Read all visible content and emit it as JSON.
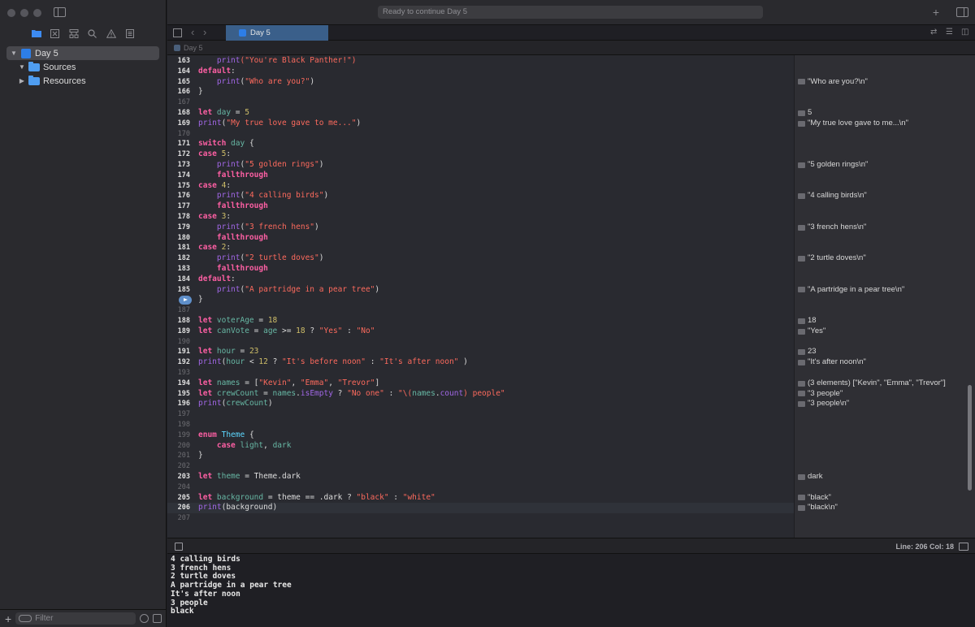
{
  "window": {
    "status": "Ready to continue Day 5"
  },
  "sidebar": {
    "tree": [
      {
        "label": "Day 5",
        "expanded": true,
        "selected": true,
        "kind": "playground"
      },
      {
        "label": "Sources",
        "expanded": true,
        "kind": "folder"
      },
      {
        "label": "Resources",
        "expanded": false,
        "kind": "folder"
      }
    ],
    "filter_placeholder": "Filter"
  },
  "tabs": [
    {
      "label": "Day 5",
      "active": true
    }
  ],
  "jumpbar": {
    "path": "Day 5"
  },
  "editor": {
    "lines": [
      {
        "n": "163",
        "code": [
          [
            "    ",
            "p"
          ],
          [
            "print",
            "f"
          ],
          [
            "(\"You're Black Panther!\")",
            "s"
          ]
        ]
      },
      {
        "n": "164",
        "code": [
          [
            "default",
            "k"
          ],
          [
            ":",
            "p"
          ]
        ]
      },
      {
        "n": "165",
        "code": [
          [
            "    ",
            "p"
          ],
          [
            "print",
            "f"
          ],
          [
            "(",
            "p"
          ],
          [
            "\"Who are you?\"",
            "s"
          ],
          [
            ")",
            "p"
          ]
        ],
        "result": "\"Who are you?\\n\""
      },
      {
        "n": "166",
        "code": [
          [
            "}",
            "p"
          ]
        ]
      },
      {
        "n": "167",
        "code": [],
        "dim": true
      },
      {
        "n": "168",
        "code": [
          [
            "let ",
            "k"
          ],
          [
            "day",
            "v"
          ],
          [
            " = ",
            "p"
          ],
          [
            "5",
            "n"
          ]
        ],
        "result": "5"
      },
      {
        "n": "169",
        "code": [
          [
            "print",
            "f"
          ],
          [
            "(",
            "p"
          ],
          [
            "\"My true love gave to me...\"",
            "s"
          ],
          [
            ")",
            "p"
          ]
        ],
        "result": "\"My true love gave to me...\\n\""
      },
      {
        "n": "170",
        "code": [],
        "dim": true
      },
      {
        "n": "171",
        "code": [
          [
            "switch ",
            "k"
          ],
          [
            "day",
            "v"
          ],
          [
            " {",
            "p"
          ]
        ]
      },
      {
        "n": "172",
        "code": [
          [
            "case ",
            "k"
          ],
          [
            "5",
            "n"
          ],
          [
            ":",
            "p"
          ]
        ]
      },
      {
        "n": "173",
        "code": [
          [
            "    ",
            "p"
          ],
          [
            "print",
            "f"
          ],
          [
            "(",
            "p"
          ],
          [
            "\"5 golden rings\"",
            "s"
          ],
          [
            ")",
            "p"
          ]
        ],
        "result": "\"5 golden rings\\n\""
      },
      {
        "n": "174",
        "code": [
          [
            "    ",
            "p"
          ],
          [
            "fallthrough",
            "k"
          ]
        ]
      },
      {
        "n": "175",
        "code": [
          [
            "case ",
            "k"
          ],
          [
            "4",
            "n"
          ],
          [
            ":",
            "p"
          ]
        ]
      },
      {
        "n": "176",
        "code": [
          [
            "    ",
            "p"
          ],
          [
            "print",
            "f"
          ],
          [
            "(",
            "p"
          ],
          [
            "\"4 calling birds\"",
            "s"
          ],
          [
            ")",
            "p"
          ]
        ],
        "result": "\"4 calling birds\\n\""
      },
      {
        "n": "177",
        "code": [
          [
            "    ",
            "p"
          ],
          [
            "fallthrough",
            "k"
          ]
        ]
      },
      {
        "n": "178",
        "code": [
          [
            "case ",
            "k"
          ],
          [
            "3",
            "n"
          ],
          [
            ":",
            "p"
          ]
        ]
      },
      {
        "n": "179",
        "code": [
          [
            "    ",
            "p"
          ],
          [
            "print",
            "f"
          ],
          [
            "(",
            "p"
          ],
          [
            "\"3 french hens\"",
            "s"
          ],
          [
            ")",
            "p"
          ]
        ],
        "result": "\"3 french hens\\n\""
      },
      {
        "n": "180",
        "code": [
          [
            "    ",
            "p"
          ],
          [
            "fallthrough",
            "k"
          ]
        ]
      },
      {
        "n": "181",
        "code": [
          [
            "case ",
            "k"
          ],
          [
            "2",
            "n"
          ],
          [
            ":",
            "p"
          ]
        ]
      },
      {
        "n": "182",
        "code": [
          [
            "    ",
            "p"
          ],
          [
            "print",
            "f"
          ],
          [
            "(",
            "p"
          ],
          [
            "\"2 turtle doves\"",
            "s"
          ],
          [
            ")",
            "p"
          ]
        ],
        "result": "\"2 turtle doves\\n\""
      },
      {
        "n": "183",
        "code": [
          [
            "    ",
            "p"
          ],
          [
            "fallthrough",
            "k"
          ]
        ]
      },
      {
        "n": "184",
        "code": [
          [
            "default",
            "k"
          ],
          [
            ":",
            "p"
          ]
        ]
      },
      {
        "n": "185",
        "code": [
          [
            "    ",
            "p"
          ],
          [
            "print",
            "f"
          ],
          [
            "(",
            "p"
          ],
          [
            "\"A partridge in a pear tree\"",
            "s"
          ],
          [
            ")",
            "p"
          ]
        ],
        "result": "\"A partridge in a pear tree\\n\""
      },
      {
        "n": "",
        "code": [
          [
            "}",
            "p"
          ]
        ],
        "run": true
      },
      {
        "n": "187",
        "code": [],
        "dim": true
      },
      {
        "n": "188",
        "code": [
          [
            "let ",
            "k"
          ],
          [
            "voterAge",
            "v"
          ],
          [
            " = ",
            "p"
          ],
          [
            "18",
            "n"
          ]
        ],
        "result": "18"
      },
      {
        "n": "189",
        "code": [
          [
            "let ",
            "k"
          ],
          [
            "canVote",
            "v"
          ],
          [
            " = ",
            "p"
          ],
          [
            "age",
            "v"
          ],
          [
            " >= ",
            "p"
          ],
          [
            "18",
            "n"
          ],
          [
            " ? ",
            "p"
          ],
          [
            "\"Yes\"",
            "s"
          ],
          [
            " : ",
            "p"
          ],
          [
            "\"No\"",
            "s"
          ]
        ],
        "result": "\"Yes\""
      },
      {
        "n": "190",
        "code": [],
        "dim": true
      },
      {
        "n": "191",
        "code": [
          [
            "let ",
            "k"
          ],
          [
            "hour",
            "v"
          ],
          [
            " = ",
            "p"
          ],
          [
            "23",
            "n"
          ]
        ],
        "result": "23"
      },
      {
        "n": "192",
        "code": [
          [
            "print",
            "f"
          ],
          [
            "(",
            "p"
          ],
          [
            "hour",
            "v"
          ],
          [
            " < ",
            "p"
          ],
          [
            "12",
            "n"
          ],
          [
            " ? ",
            "p"
          ],
          [
            "\"It's before noon\"",
            "s"
          ],
          [
            " : ",
            "p"
          ],
          [
            "\"It's after noon\"",
            "s"
          ],
          [
            " )",
            "p"
          ]
        ],
        "result": "\"It's after noon\\n\""
      },
      {
        "n": "193",
        "code": [],
        "dim": true
      },
      {
        "n": "194",
        "code": [
          [
            "let ",
            "k"
          ],
          [
            "names",
            "v"
          ],
          [
            " = [",
            "p"
          ],
          [
            "\"Kevin\"",
            "s"
          ],
          [
            ", ",
            "p"
          ],
          [
            "\"Emma\"",
            "s"
          ],
          [
            ", ",
            "p"
          ],
          [
            "\"Trevor\"",
            "s"
          ],
          [
            "]",
            "p"
          ]
        ],
        "result": "(3 elements) [\"Kevin\", \"Emma\", \"Trevor\"]"
      },
      {
        "n": "195",
        "code": [
          [
            "let ",
            "k"
          ],
          [
            "crewCount",
            "v"
          ],
          [
            " = ",
            "p"
          ],
          [
            "names",
            "v"
          ],
          [
            ".",
            "p"
          ],
          [
            "isEmpty",
            "f"
          ],
          [
            " ? ",
            "p"
          ],
          [
            "\"No one\"",
            "s"
          ],
          [
            " : ",
            "p"
          ],
          [
            "\"\\(",
            "s"
          ],
          [
            "names",
            "v"
          ],
          [
            ".",
            "p"
          ],
          [
            "count",
            "f"
          ],
          [
            ") people\"",
            "s"
          ]
        ],
        "result": "\"3 people\""
      },
      {
        "n": "196",
        "code": [
          [
            "print",
            "f"
          ],
          [
            "(",
            "p"
          ],
          [
            "crewCount",
            "v"
          ],
          [
            ")",
            "p"
          ]
        ],
        "result": "\"3 people\\n\""
      },
      {
        "n": "197",
        "code": [],
        "dim": true
      },
      {
        "n": "198",
        "code": [],
        "dim": true
      },
      {
        "n": "199",
        "code": [
          [
            "enum ",
            "k"
          ],
          [
            "Theme",
            "t"
          ],
          [
            " {",
            "p"
          ]
        ],
        "dim": true
      },
      {
        "n": "200",
        "code": [
          [
            "    ",
            "p"
          ],
          [
            "case ",
            "k"
          ],
          [
            "light",
            "v"
          ],
          [
            ", ",
            "p"
          ],
          [
            "dark",
            "v"
          ]
        ],
        "dim": true
      },
      {
        "n": "201",
        "code": [
          [
            "}",
            "p"
          ]
        ],
        "dim": true
      },
      {
        "n": "202",
        "code": [],
        "dim": true
      },
      {
        "n": "203",
        "code": [
          [
            "let ",
            "k"
          ],
          [
            "theme",
            "v"
          ],
          [
            " = ",
            "p"
          ],
          [
            "Theme",
            "p"
          ],
          [
            ".dark",
            "p"
          ]
        ],
        "result": "dark"
      },
      {
        "n": "204",
        "code": [],
        "dim": true
      },
      {
        "n": "205",
        "code": [
          [
            "let ",
            "k"
          ],
          [
            "background",
            "v"
          ],
          [
            " = ",
            "p"
          ],
          [
            "theme",
            "p"
          ],
          [
            " == .dark ? ",
            "p"
          ],
          [
            "\"black\"",
            "s"
          ],
          [
            " : ",
            "p"
          ],
          [
            "\"white\"",
            "s"
          ]
        ],
        "result": "\"black\""
      },
      {
        "n": "206",
        "code": [
          [
            "print",
            "f"
          ],
          [
            "(background)",
            "p"
          ]
        ],
        "result": "\"black\\n\"",
        "current": true
      },
      {
        "n": "207",
        "code": [],
        "dim": true
      }
    ]
  },
  "debug": {
    "cursor": "Line: 206  Col: 18"
  },
  "console": {
    "lines": [
      "4 calling birds",
      "3 french hens",
      "2 turtle doves",
      "A partridge in a pear tree",
      "It's after noon",
      "3 people",
      "black"
    ]
  },
  "colors": {
    "keyword": "#fc5fa3",
    "string": "#fc6a5d",
    "number": "#d0bf69",
    "variable": "#67b7a4",
    "type": "#5dd8ff",
    "function": "#a167e6",
    "tab_active": "#3a5f8a"
  },
  "icons": [
    "sidebar-toggle-icon",
    "folder-icon",
    "x-square-icon",
    "hierarchy-icon",
    "search-icon",
    "warning-icon",
    "list-icon",
    "plus-icon",
    "filter-icon",
    "grid-icon",
    "chevron-left-icon",
    "chevron-right-icon",
    "swift-icon",
    "swap-icon",
    "editor-options-icon",
    "inspector-icon",
    "run-icon",
    "checkbox-icon",
    "panel-icon"
  ]
}
